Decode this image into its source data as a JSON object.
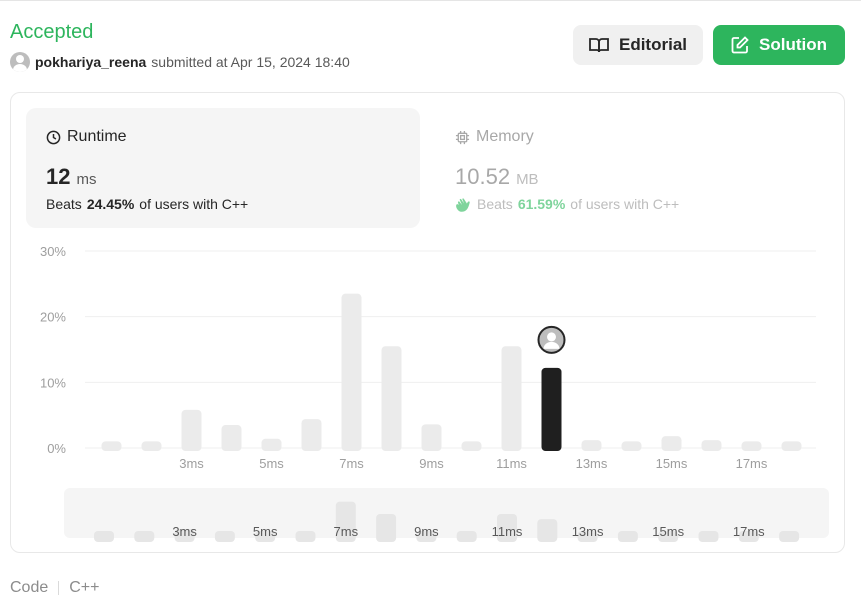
{
  "submission": {
    "status": "Accepted",
    "username": "pokhariya_reena",
    "submitted_text": "submitted at Apr 15, 2024 18:40"
  },
  "buttons": {
    "editorial": "Editorial",
    "solution": "Solution"
  },
  "runtime": {
    "label": "Runtime",
    "value": "12",
    "unit": "ms",
    "beats_prefix": "Beats",
    "beats_pct": "24.45%",
    "beats_suffix": "of users with C++",
    "icon": "clock-icon"
  },
  "memory": {
    "label": "Memory",
    "value": "10.52",
    "unit": "MB",
    "beats_prefix": "Beats",
    "beats_pct": "61.59%",
    "beats_suffix": "of users with C++",
    "icon": "chip-icon"
  },
  "footer": {
    "code_label": "Code",
    "language": "C++"
  },
  "colors": {
    "accent_green": "#2db55d",
    "bar_inactive": "#ebebeb",
    "bar_active": "#1f1f1f"
  },
  "chart_data": {
    "type": "bar",
    "y_ticks": [
      "30%",
      "20%",
      "10%",
      "0%"
    ],
    "ylim": [
      0,
      30
    ],
    "x_tick_labels": [
      "3ms",
      "5ms",
      "7ms",
      "9ms",
      "11ms",
      "13ms",
      "15ms",
      "17ms"
    ],
    "values": [
      1.0,
      1.0,
      5.8,
      3.5,
      1.4,
      4.4,
      23.5,
      15.5,
      3.6,
      1.0,
      15.5,
      12.2,
      1.2,
      1.0,
      1.8,
      1.2,
      1.0,
      1.0
    ],
    "highlight_index": 11,
    "grid": true
  }
}
